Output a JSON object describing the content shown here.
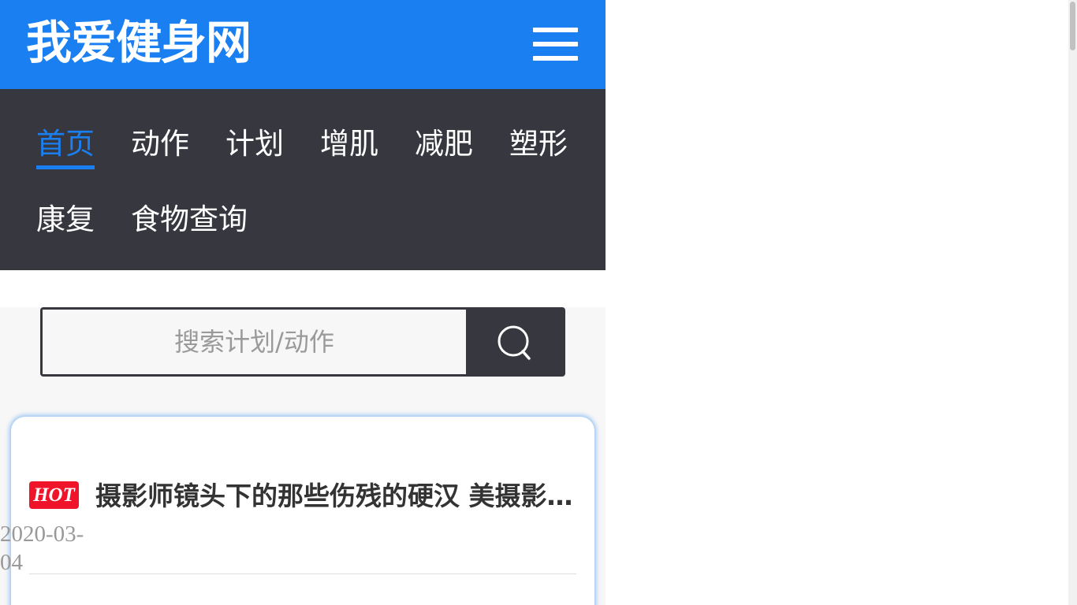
{
  "header": {
    "site_title": "我爱健身网",
    "menu_icon": "hamburger-menu-icon",
    "background_color": "#1a80f2"
  },
  "nav": {
    "background_color": "#373740",
    "active_color": "#1a80f2",
    "items": [
      {
        "label": "首页",
        "active": true
      },
      {
        "label": "动作"
      },
      {
        "label": "计划"
      },
      {
        "label": "增肌"
      },
      {
        "label": "减肥"
      },
      {
        "label": "塑形"
      },
      {
        "label": "康复"
      },
      {
        "label": "食物查询"
      }
    ]
  },
  "search": {
    "placeholder": "搜索计划/动作",
    "button_icon": "search-icon"
  },
  "articles": [
    {
      "badge": "HOT",
      "title": "摄影师镜头下的那些伤残的硬汉 美摄影师镜头下的那些伤残的硬汉",
      "date": "2020-03-04"
    }
  ],
  "colors": {
    "hot_badge": "#f0142a"
  }
}
